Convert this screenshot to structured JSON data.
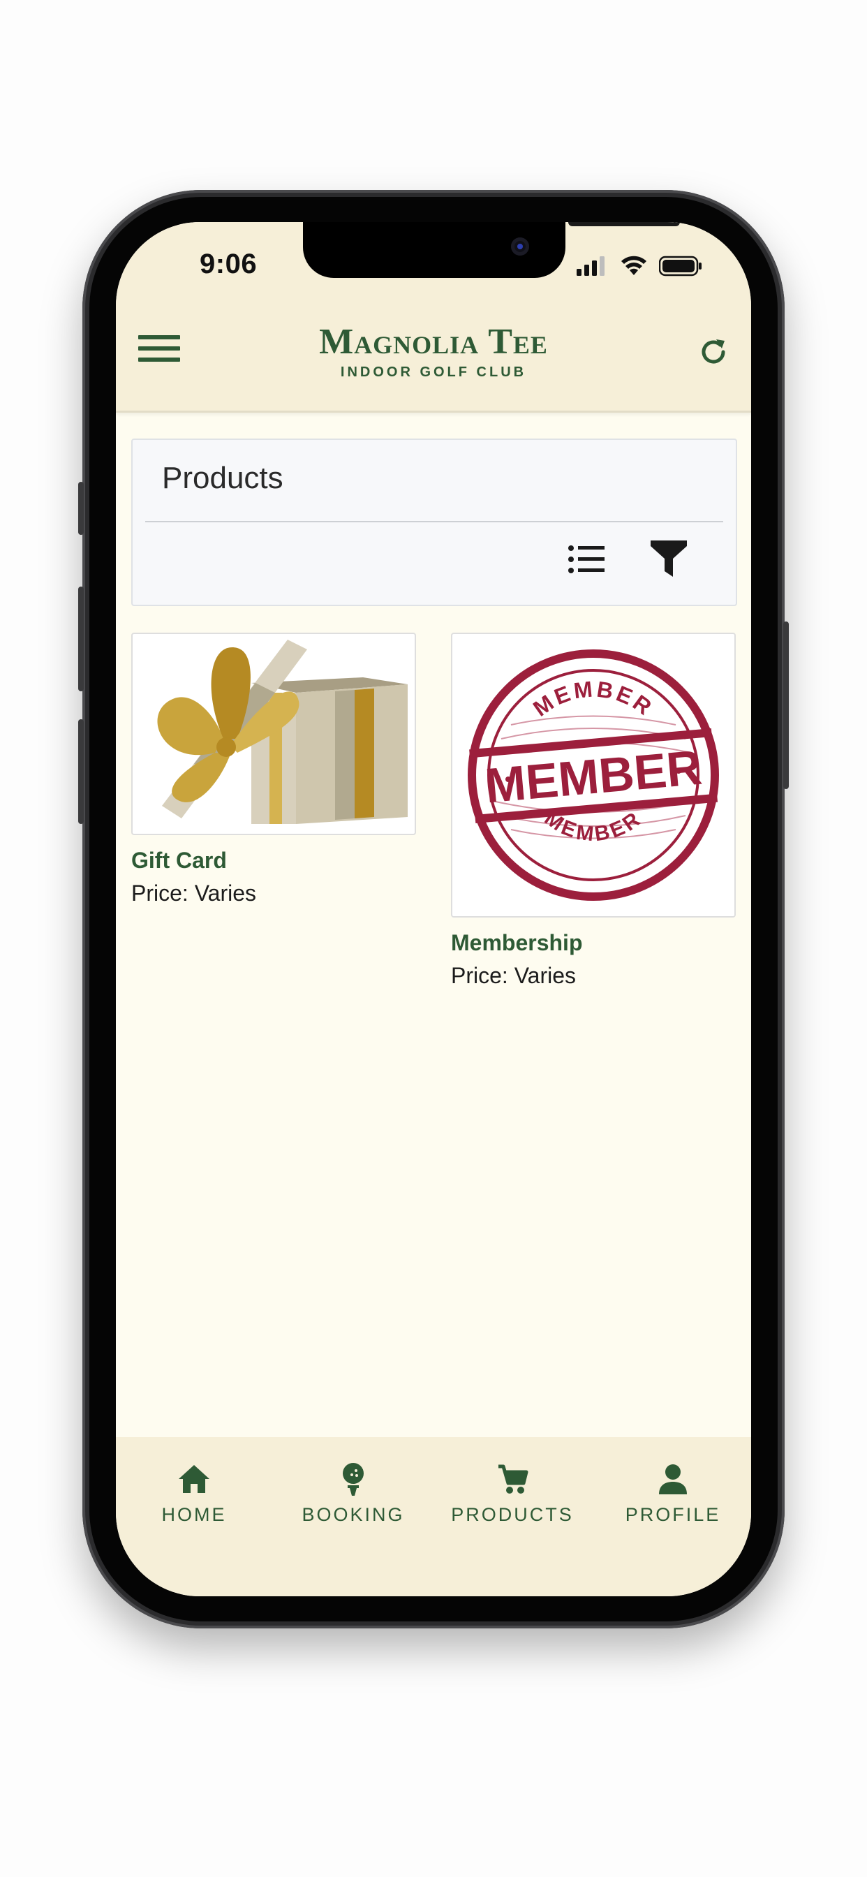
{
  "status_bar": {
    "time": "9:06"
  },
  "header": {
    "title": "Magnolia Tee",
    "subtitle": "INDOOR GOLF CLUB"
  },
  "products_panel": {
    "title": "Products"
  },
  "products": [
    {
      "name": "Gift Card",
      "price": "Price: Varies",
      "image_icon": "gift-box-image"
    },
    {
      "name": "Membership",
      "price": "Price: Varies",
      "image_icon": "member-stamp-image",
      "image_text": [
        "MEMBER",
        "MEMBER",
        "MEMBER"
      ]
    }
  ],
  "bottom_nav": [
    {
      "label": "HOME",
      "icon": "home-icon"
    },
    {
      "label": "BOOKING",
      "icon": "golf-ball-tee-icon"
    },
    {
      "label": "PRODUCTS",
      "icon": "cart-icon"
    },
    {
      "label": "PROFILE",
      "icon": "person-icon"
    }
  ],
  "colors": {
    "brand_green": "#2e5a35",
    "header_bg": "#f6efd8",
    "page_bg": "#fefcf0",
    "stamp_red": "#9c1f3c",
    "gift_gold": "#c9a43c"
  }
}
